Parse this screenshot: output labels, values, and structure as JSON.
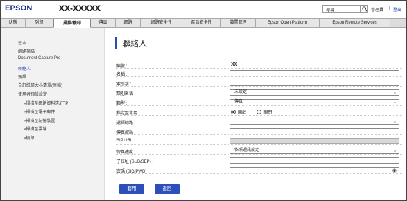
{
  "header": {
    "logo": "EPSON",
    "model": "XX-XXXXX",
    "search_placeholder": "搜尋",
    "admin": "管理員",
    "separator": "|",
    "logout": "登出"
  },
  "tabs": [
    {
      "label": "狀態"
    },
    {
      "label": "列印"
    },
    {
      "label": "掃描/複印",
      "active": true
    },
    {
      "label": "傳真"
    },
    {
      "label": "網路"
    },
    {
      "label": "網路安全性"
    },
    {
      "label": "產品安全性"
    },
    {
      "label": "裝置管理"
    },
    {
      "label": "Epson Open Platform"
    },
    {
      "label": "Epson Remote Services"
    }
  ],
  "sidebar": {
    "items": [
      {
        "label": "基本"
      },
      {
        "label": "網路掃描"
      },
      {
        "label": "Document Capture Pro"
      },
      {
        "label": "聯絡人",
        "active": true
      },
      {
        "label": "預設"
      },
      {
        "label": "自訂紙張大小清單(原稿)"
      },
      {
        "label": "使用者預設設定"
      },
      {
        "label": "»掃描至網路資料夾/FTP",
        "sub": true
      },
      {
        "label": "»掃描至電子郵件",
        "sub": true
      },
      {
        "label": "»掃描至記憶裝置",
        "sub": true
      },
      {
        "label": "»掃描至雲端",
        "sub": true
      },
      {
        "label": "»複印",
        "sub": true
      }
    ]
  },
  "main": {
    "title": "聯絡人",
    "rows": {
      "number": {
        "label": "編號 :",
        "value": "XX"
      },
      "name": {
        "label": "名稱 :"
      },
      "index_word": {
        "label": "索引字 :"
      },
      "group_name": {
        "label": "類別名稱 :",
        "value": "未設定"
      },
      "type": {
        "label": "類型 :",
        "value": "傳真"
      },
      "assign": {
        "label": "指定至常用 :",
        "on": "開啟",
        "off": "關閉"
      },
      "line": {
        "label": "選擇線路 :"
      },
      "fax_number": {
        "label": "傳真號碼 :"
      },
      "sip_uri": {
        "label": "SIP URI :"
      },
      "fax_speed": {
        "label": "傳真速度 :",
        "value": "依照通訊設定"
      },
      "subaddress": {
        "label": "子位址 (SUB/SEP) :"
      },
      "password": {
        "label": "密碼 (SID/PWD) :"
      }
    },
    "apply": "套用",
    "back": "返回"
  }
}
